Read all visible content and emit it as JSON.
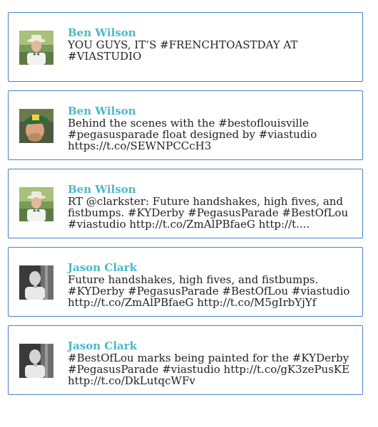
{
  "tweets": [
    {
      "author": "Ben Wilson",
      "text": "YOU GUYS, IT’S #FRENCHTOASTDAY AT #VIASTUDIO",
      "avatar_icon": "ben-wilson-bowtie-photo"
    },
    {
      "author": "Ben Wilson",
      "text": "Behind the scenes with the #bestoflouisville #pegasusparade float designed by #viastudio https://t.co/SEWNPCCcH3",
      "avatar_icon": "ben-wilson-cap-photo"
    },
    {
      "author": "Ben Wilson",
      "text": "RT @clarkster: Future handshakes, high fives, and fistbumps. #KYDerby #PegasusParade #BestOfLou #viastudio http://t.co/ZmAlPBfaeG http://t....",
      "avatar_icon": "ben-wilson-bowtie-photo"
    },
    {
      "author": "Jason Clark",
      "text": "Future handshakes, high fives, and fistbumps. #KYDerby #PegasusParade #BestOfLou #viastudio http://t.co/ZmAlPBfaeG http://t.co/M5gIrbYjYf",
      "avatar_icon": "jason-clark-bw-photo"
    },
    {
      "author": "Jason Clark",
      "text": "#BestOfLou marks being painted for the #KYDerby #PegasusParade #viastudio http://t.co/gK3zePusKE http://t.co/DkLutqcWFv",
      "avatar_icon": "jason-clark-bw-photo"
    }
  ]
}
